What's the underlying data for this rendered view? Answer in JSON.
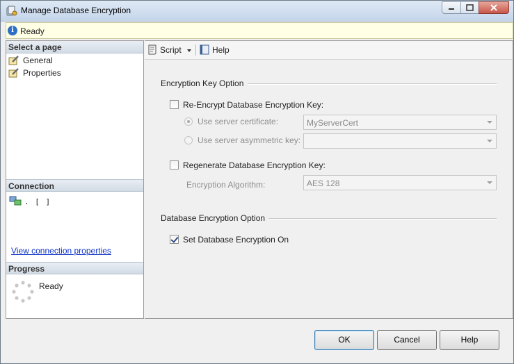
{
  "window": {
    "title": "Manage Database Encryption"
  },
  "status": {
    "text": "Ready",
    "icon": "info-icon"
  },
  "left": {
    "select_page_header": "Select a page",
    "pages": [
      {
        "label": "General"
      },
      {
        "label": "Properties"
      }
    ],
    "connection_header": "Connection",
    "connection_value": ". [                    ]",
    "connection_link": "View connection properties",
    "progress_header": "Progress",
    "progress_text": "Ready"
  },
  "toolbar": {
    "script_label": "Script",
    "help_label": "Help"
  },
  "encryption_key_group": {
    "title": "Encryption Key Option",
    "reencrypt_label": "Re-Encrypt Database Encryption Key:",
    "reencrypt_checked": false,
    "use_server_cert_label": "Use server certificate:",
    "use_server_cert_value": "MyServerCert",
    "use_asym_key_label": "Use server asymmetric key:",
    "use_asym_key_value": "",
    "regenerate_label": "Regenerate Database Encryption Key:",
    "regenerate_checked": false,
    "algorithm_label": "Encryption Algorithm:",
    "algorithm_value": "AES 128"
  },
  "db_encryption_group": {
    "title": "Database Encryption Option",
    "set_encryption_label": "Set Database Encryption On",
    "set_encryption_checked": true
  },
  "footer": {
    "ok_label": "OK",
    "cancel_label": "Cancel",
    "help_label": "Help"
  }
}
